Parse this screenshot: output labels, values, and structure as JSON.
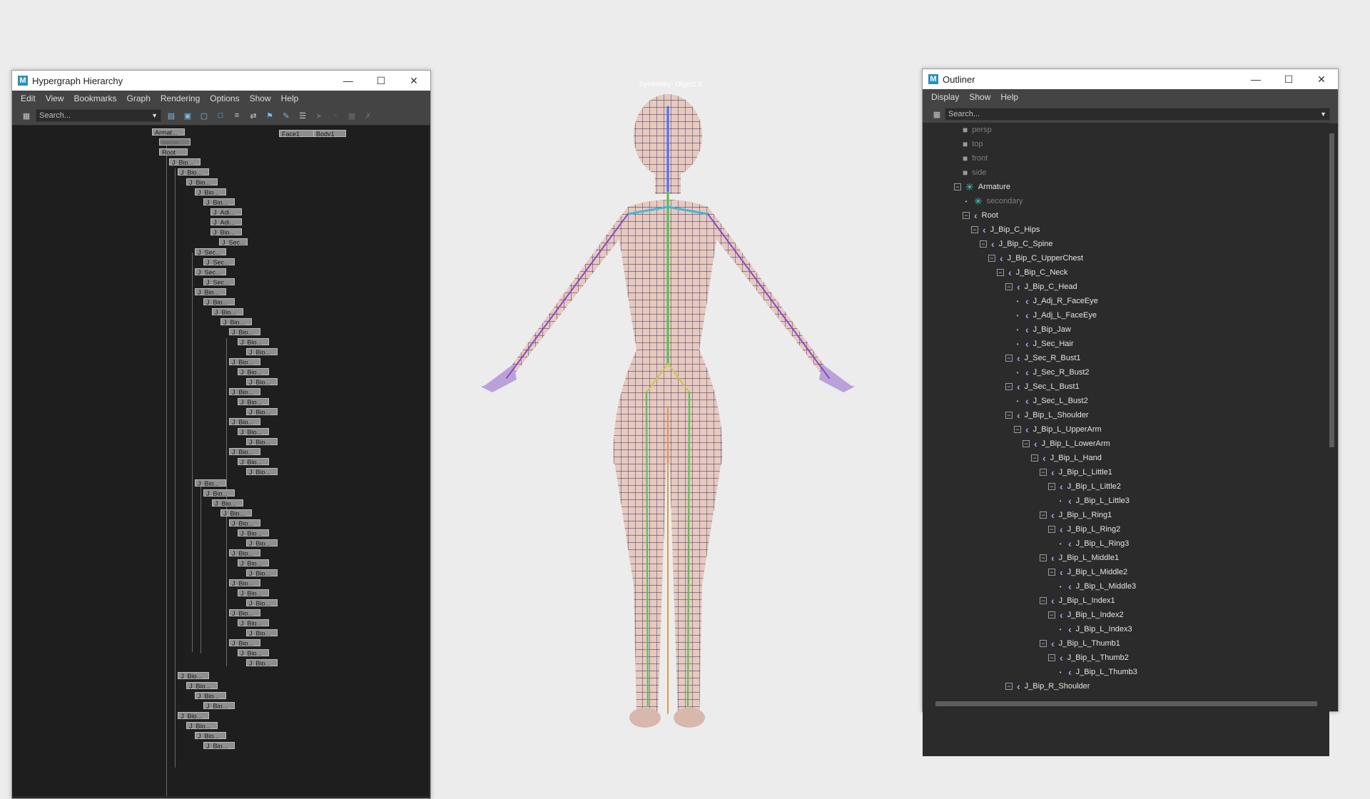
{
  "hypergraph": {
    "title": "Hypergraph Hierarchy",
    "menu": [
      "Edit",
      "View",
      "Bookmarks",
      "Graph",
      "Rendering",
      "Options",
      "Show",
      "Help"
    ],
    "search_placeholder": "Search...",
    "nodes": [
      {
        "label": "Armat..."
      },
      {
        "label": "secon..."
      },
      {
        "label": "Root"
      },
      {
        "label": "J_Bip..."
      },
      {
        "label": "Face1"
      },
      {
        "label": "Body1"
      },
      {
        "label": "J_Bip..."
      },
      {
        "label": "J_Bip..."
      },
      {
        "label": "J_Bip..."
      },
      {
        "label": "J_Bip..."
      },
      {
        "label": "J_Adj..."
      },
      {
        "label": "J_Adj..."
      },
      {
        "label": "J_Bip..."
      },
      {
        "label": "J_Sec..."
      },
      {
        "label": "J_Sec..."
      },
      {
        "label": "J_Sec..."
      },
      {
        "label": "J_Sec..."
      },
      {
        "label": "J_Sec..."
      },
      {
        "label": "J_Bip..."
      },
      {
        "label": "J_Bip..."
      },
      {
        "label": "J_Bip..."
      },
      {
        "label": "J_Bip..."
      },
      {
        "label": "J_Bip..."
      },
      {
        "label": "J_Bip..."
      },
      {
        "label": "J_Bip..."
      },
      {
        "label": "J_Bip..."
      },
      {
        "label": "J_Bip..."
      },
      {
        "label": "J_Bip..."
      },
      {
        "label": "J_Bip..."
      },
      {
        "label": "J_Bip..."
      },
      {
        "label": "J_Bip..."
      },
      {
        "label": "J_Bip..."
      },
      {
        "label": "J_Bip..."
      },
      {
        "label": "J_Bip..."
      },
      {
        "label": "J_Bip..."
      },
      {
        "label": "J_Bip..."
      },
      {
        "label": "J_Bip..."
      },
      {
        "label": "J_Bip..."
      },
      {
        "label": "J_Bip..."
      },
      {
        "label": "J_Bip..."
      },
      {
        "label": "J_Bip..."
      },
      {
        "label": "J_Bip..."
      },
      {
        "label": "J_Bip..."
      },
      {
        "label": "J_Bip..."
      },
      {
        "label": "J_Bip..."
      },
      {
        "label": "J_Bip..."
      },
      {
        "label": "J_Bip..."
      },
      {
        "label": "J_Bip..."
      },
      {
        "label": "J_Bip..."
      },
      {
        "label": "J_Bip..."
      },
      {
        "label": "J_Bip..."
      },
      {
        "label": "J_Bip..."
      },
      {
        "label": "J_Bip..."
      },
      {
        "label": "J_Bip..."
      },
      {
        "label": "J_Bip..."
      },
      {
        "label": "J_Bip..."
      },
      {
        "label": "J_Bip..."
      },
      {
        "label": "J_Bip..."
      },
      {
        "label": "J_Bip..."
      },
      {
        "label": "J_Bip..."
      },
      {
        "label": "J_Bip..."
      },
      {
        "label": "J_Bip..."
      },
      {
        "label": "J_Bip..."
      },
      {
        "label": "J_Bip..."
      }
    ]
  },
  "viewport": {
    "symmetry_label": "Symmetry: Object X"
  },
  "outliner": {
    "title": "Outliner",
    "menu": [
      "Display",
      "Show",
      "Help"
    ],
    "search_placeholder": "Search...",
    "items": [
      {
        "label": "persp",
        "icon": "camera-icon",
        "dim": true
      },
      {
        "label": "top",
        "icon": "camera-icon",
        "dim": true
      },
      {
        "label": "front",
        "icon": "camera-icon",
        "dim": true
      },
      {
        "label": "side",
        "icon": "camera-icon",
        "dim": true
      },
      {
        "label": "Armature",
        "icon": "locator-icon"
      },
      {
        "label": "secondary",
        "icon": "locator-icon",
        "dim": true
      },
      {
        "label": "Root",
        "icon": "joint-icon"
      },
      {
        "label": "J_Bip_C_Hips",
        "icon": "joint-icon"
      },
      {
        "label": "J_Bip_C_Spine",
        "icon": "joint-icon"
      },
      {
        "label": "J_Bip_C_UpperChest",
        "icon": "joint-icon"
      },
      {
        "label": "J_Bip_C_Neck",
        "icon": "joint-icon"
      },
      {
        "label": "J_Bip_C_Head",
        "icon": "joint-icon"
      },
      {
        "label": "J_Adj_R_FaceEye",
        "icon": "joint-icon"
      },
      {
        "label": "J_Adj_L_FaceEye",
        "icon": "joint-icon"
      },
      {
        "label": "J_Bip_Jaw",
        "icon": "joint-icon"
      },
      {
        "label": "J_Sec_Hair",
        "icon": "joint-icon"
      },
      {
        "label": "J_Sec_R_Bust1",
        "icon": "joint-icon"
      },
      {
        "label": "J_Sec_R_Bust2",
        "icon": "joint-icon"
      },
      {
        "label": "J_Sec_L_Bust1",
        "icon": "joint-icon"
      },
      {
        "label": "J_Sec_L_Bust2",
        "icon": "joint-icon"
      },
      {
        "label": "J_Bip_L_Shoulder",
        "icon": "joint-icon"
      },
      {
        "label": "J_Bip_L_UpperArm",
        "icon": "joint-icon"
      },
      {
        "label": "J_Bip_L_LowerArm",
        "icon": "joint-icon"
      },
      {
        "label": "J_Bip_L_Hand",
        "icon": "joint-icon"
      },
      {
        "label": "J_Bip_L_Little1",
        "icon": "joint-icon"
      },
      {
        "label": "J_Bip_L_Little2",
        "icon": "joint-icon"
      },
      {
        "label": "J_Bip_L_Little3",
        "icon": "joint-icon"
      },
      {
        "label": "J_Bip_L_Ring1",
        "icon": "joint-icon"
      },
      {
        "label": "J_Bip_L_Ring2",
        "icon": "joint-icon"
      },
      {
        "label": "J_Bip_L_Ring3",
        "icon": "joint-icon"
      },
      {
        "label": "J_Bip_L_Middle1",
        "icon": "joint-icon"
      },
      {
        "label": "J_Bip_L_Middle2",
        "icon": "joint-icon"
      },
      {
        "label": "J_Bip_L_Middle3",
        "icon": "joint-icon"
      },
      {
        "label": "J_Bip_L_Index1",
        "icon": "joint-icon"
      },
      {
        "label": "J_Bip_L_Index2",
        "icon": "joint-icon"
      },
      {
        "label": "J_Bip_L_Index3",
        "icon": "joint-icon"
      },
      {
        "label": "J_Bip_L_Thumb1",
        "icon": "joint-icon"
      },
      {
        "label": "J_Bip_L_Thumb2",
        "icon": "joint-icon"
      },
      {
        "label": "J_Bip_L_Thumb3",
        "icon": "joint-icon"
      },
      {
        "label": "J_Bip_R_Shoulder",
        "icon": "joint-icon"
      }
    ]
  },
  "colors": {
    "panel_bg": "#2b2b2b",
    "hypergraph_bg": "#1e1e1e",
    "joint_icon": "#a9a2e8",
    "locator_icon": "#3fd0c7",
    "maya_logo": "#2a8fb9"
  }
}
